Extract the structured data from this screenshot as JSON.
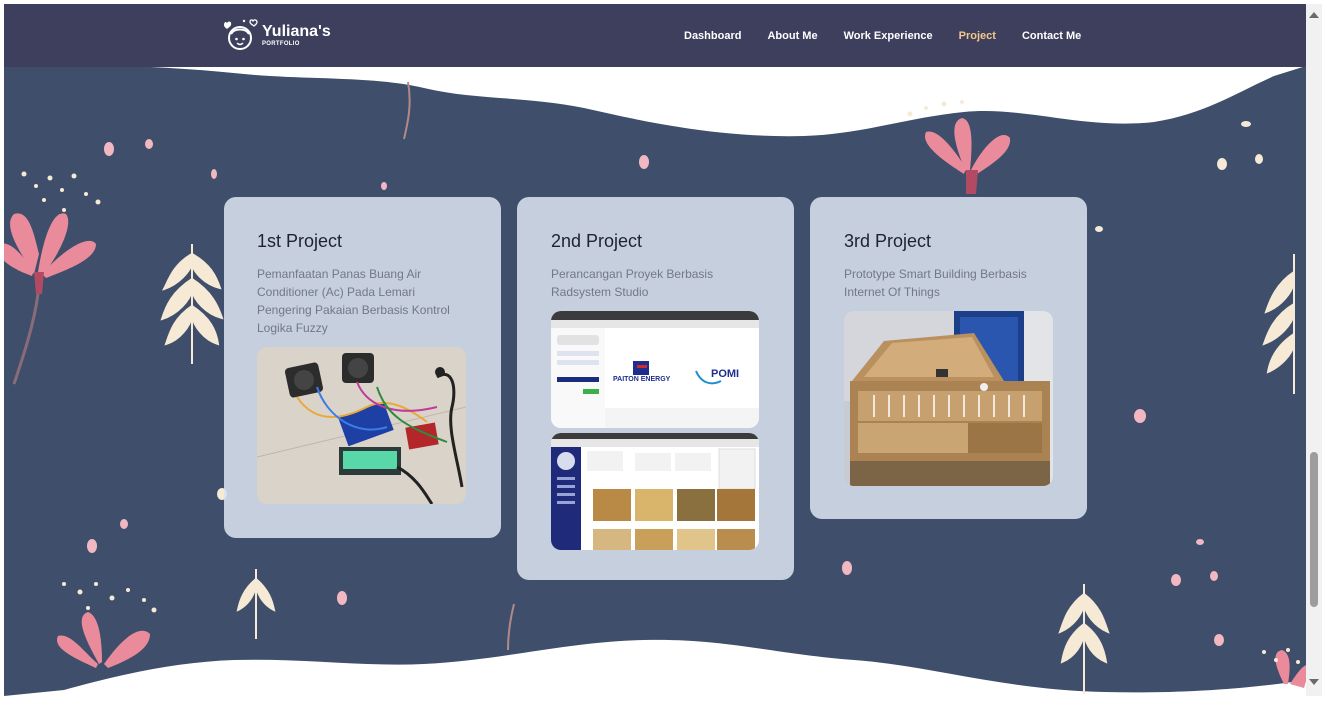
{
  "brand": {
    "title": "Yuliana's",
    "subtitle": "PORTFOLIO"
  },
  "nav": {
    "items": [
      {
        "label": "Dashboard",
        "active": false
      },
      {
        "label": "About Me",
        "active": false
      },
      {
        "label": "Work Experience",
        "active": false
      },
      {
        "label": "Project",
        "active": true
      },
      {
        "label": "Contact Me",
        "active": false
      }
    ]
  },
  "projects": [
    {
      "title": "1st Project",
      "description": "Pemanfaatan Panas Buang Air Conditioner (Ac) Pada Lemari Pengering Pakaian Berbasis Kontrol Logika Fuzzy"
    },
    {
      "title": "2nd Project",
      "description": "Perancangan Proyek Berbasis Radsystem Studio",
      "screenshot_labels": {
        "company": "PAITON ENERGY",
        "brand2": "POMI"
      }
    },
    {
      "title": "3rd Project",
      "description": "Prototype Smart Building Berbasis Internet Of Things"
    }
  ],
  "colors": {
    "navbar": "#3d3f5c",
    "background": "#3f4f6b",
    "active_nav": "#f2c88a",
    "card": "#dae1ed"
  }
}
